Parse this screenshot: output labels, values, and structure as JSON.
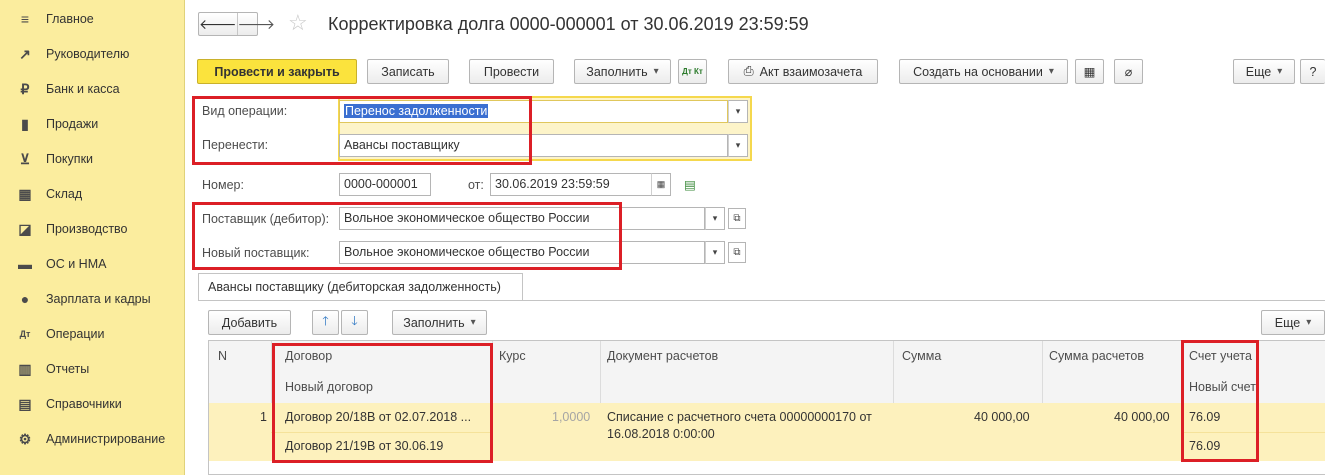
{
  "sidebar": {
    "items": [
      {
        "icon": "menu-icon",
        "glyph": "≡",
        "label": "Главное"
      },
      {
        "icon": "trend-icon",
        "glyph": "↗",
        "label": "Руководителю"
      },
      {
        "icon": "ruble-coin-icon",
        "glyph": "₽",
        "label": "Банк и касса"
      },
      {
        "icon": "bag-icon",
        "glyph": "▮",
        "label": "Продажи"
      },
      {
        "icon": "cart-icon",
        "glyph": "⊻",
        "label": "Покупки"
      },
      {
        "icon": "warehouse-icon",
        "glyph": "▦",
        "label": "Склад"
      },
      {
        "icon": "factory-icon",
        "glyph": "◪",
        "label": "Производство"
      },
      {
        "icon": "truck-icon",
        "glyph": "▬",
        "label": "ОС и НМА"
      },
      {
        "icon": "person-icon",
        "glyph": "●",
        "label": "Зарплата и кадры"
      },
      {
        "icon": "dt-kt-icon",
        "glyph": "Дт",
        "label": "Операции"
      },
      {
        "icon": "bar-chart-icon",
        "glyph": "▥",
        "label": "Отчеты"
      },
      {
        "icon": "books-icon",
        "glyph": "▤",
        "label": "Справочники"
      },
      {
        "icon": "gear-icon",
        "glyph": "⚙",
        "label": "Администрирование"
      }
    ]
  },
  "header": {
    "title": "Корректировка долга 0000-000001 от 30.06.2019 23:59:59"
  },
  "toolbar": {
    "post_close": "Провести и закрыть",
    "save": "Записать",
    "post": "Провести",
    "fill": "Заполнить",
    "dt_kt": "Дт Кт",
    "print_act": "Акт взаимозачета",
    "create_based": "Создать на основании",
    "more": "Еще",
    "help": "?"
  },
  "form": {
    "operation_label": "Вид операции:",
    "operation_value": "Перенос задолженности",
    "transfer_label": "Перенести:",
    "transfer_value": "Авансы поставщику",
    "number_label": "Номер:",
    "number_value": "0000-000001",
    "date_label": "от:",
    "date_value": "30.06.2019 23:59:59",
    "supplier_label": "Поставщик (дебитор):",
    "supplier_value": "Вольное экономическое общество России",
    "new_supplier_label": "Новый поставщик:",
    "new_supplier_value": "Вольное экономическое общество России"
  },
  "tab": {
    "label": "Авансы поставщику (дебиторская задолженность)"
  },
  "table_toolbar": {
    "add": "Добавить",
    "fill": "Заполнить",
    "more": "Еще"
  },
  "table": {
    "headers": {
      "n": "N",
      "contract": "Договор",
      "new_contract": "Новый договор",
      "rate": "Курс",
      "doc": "Документ расчетов",
      "sum": "Сумма",
      "sum_settle": "Сумма расчетов",
      "account": "Счет учета",
      "new_account": "Новый счет"
    },
    "rows": [
      {
        "n": "1",
        "contract": "Договор 20/18В от 02.07.2018 ...",
        "new_contract": "Договор 21/19В от 30.06.19",
        "rate": "1,0000",
        "doc_line1": "Списание с расчетного счета 00000000170 от",
        "doc_line2": "16.08.2018 0:00:00",
        "sum": "40 000,00",
        "sum_settle": "40 000,00",
        "account": "76.09",
        "new_account": "76.09"
      }
    ]
  },
  "colors": {
    "sidebar_bg": "#fbed9e",
    "primary_button": "#fbe33d",
    "highlight_red": "#dc1f26",
    "selected_row": "#fdf1bd"
  }
}
